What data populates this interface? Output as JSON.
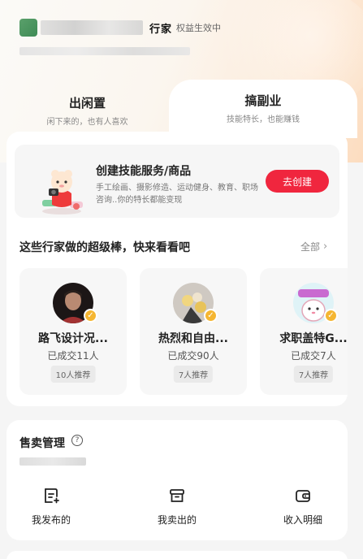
{
  "header": {
    "brand": "行家",
    "status": "权益生效中"
  },
  "tabs": [
    {
      "title": "出闲置",
      "subtitle": "闲下来的，也有人喜欢"
    },
    {
      "title": "搞副业",
      "subtitle": "技能特长，也能赚钱"
    }
  ],
  "create": {
    "title": "创建技能服务/商品",
    "description": "手工绘画、摄影修造、运动健身、教育、职场咨询..你的特长都能变现",
    "button": "去创建"
  },
  "featured": {
    "title": "这些行家做的超级棒，快来看看吧",
    "see_all": "全部",
    "creators": [
      {
        "name": "路飞设计况...",
        "deals": "已成交11人",
        "recommend": "10人推荐"
      },
      {
        "name": "热烈和自由...",
        "deals": "已成交90人",
        "recommend": "7人推荐"
      },
      {
        "name": "求职盖特G...",
        "deals": "已成交7人",
        "recommend": "7人推荐"
      }
    ]
  },
  "sales": {
    "title": "售卖管理",
    "help_icon": "help-circle-icon",
    "items": [
      {
        "label": "我发布的",
        "icon": "published-list-icon"
      },
      {
        "label": "我卖出的",
        "icon": "sold-box-icon"
      },
      {
        "label": "收入明细",
        "icon": "wallet-icon"
      }
    ]
  },
  "colors": {
    "accent": "#f0263e",
    "badge": "#f5b632"
  }
}
